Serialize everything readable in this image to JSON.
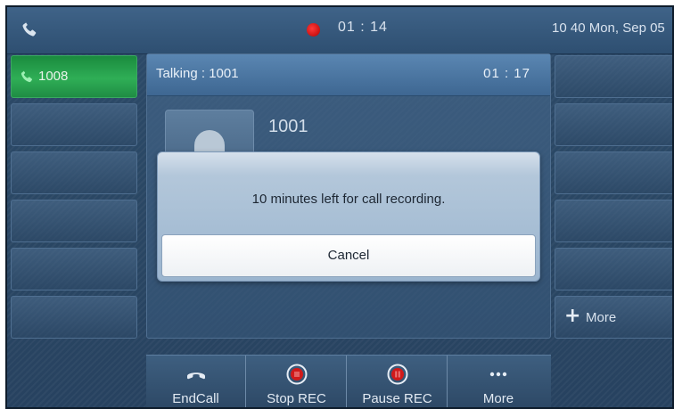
{
  "statusbar": {
    "recording_time": "01 : 14",
    "datetime": "10 40 Mon, Sep 05",
    "recording_color": "#e01b1b"
  },
  "line_keys": [
    {
      "label": "1008",
      "active": true,
      "icon": "phone-icon"
    },
    {
      "label": "",
      "active": false
    },
    {
      "label": "",
      "active": false
    },
    {
      "label": "",
      "active": false
    },
    {
      "label": "",
      "active": false
    },
    {
      "label": "",
      "active": false
    }
  ],
  "right_keys": [
    {
      "label": ""
    },
    {
      "label": ""
    },
    {
      "label": ""
    },
    {
      "label": ""
    },
    {
      "label": ""
    },
    {
      "label": "More",
      "icon": "plus-icon"
    }
  ],
  "call": {
    "title": "Talking : 1001",
    "duration": "01 : 17",
    "callee": "1001",
    "avatar_icon": "person-icon"
  },
  "dialog": {
    "message": "10 minutes left for call recording.",
    "cancel_label": "Cancel"
  },
  "softkeys": [
    {
      "label": "EndCall",
      "icon": "handset-icon"
    },
    {
      "label": "Stop REC",
      "icon": "stop-record-icon"
    },
    {
      "label": "Pause REC",
      "icon": "pause-record-icon"
    },
    {
      "label": "More",
      "icon": "more-dots-icon"
    }
  ],
  "colors": {
    "accent_green": "#2fae56",
    "record_red": "#e01b1b",
    "background": "#2a4764"
  }
}
